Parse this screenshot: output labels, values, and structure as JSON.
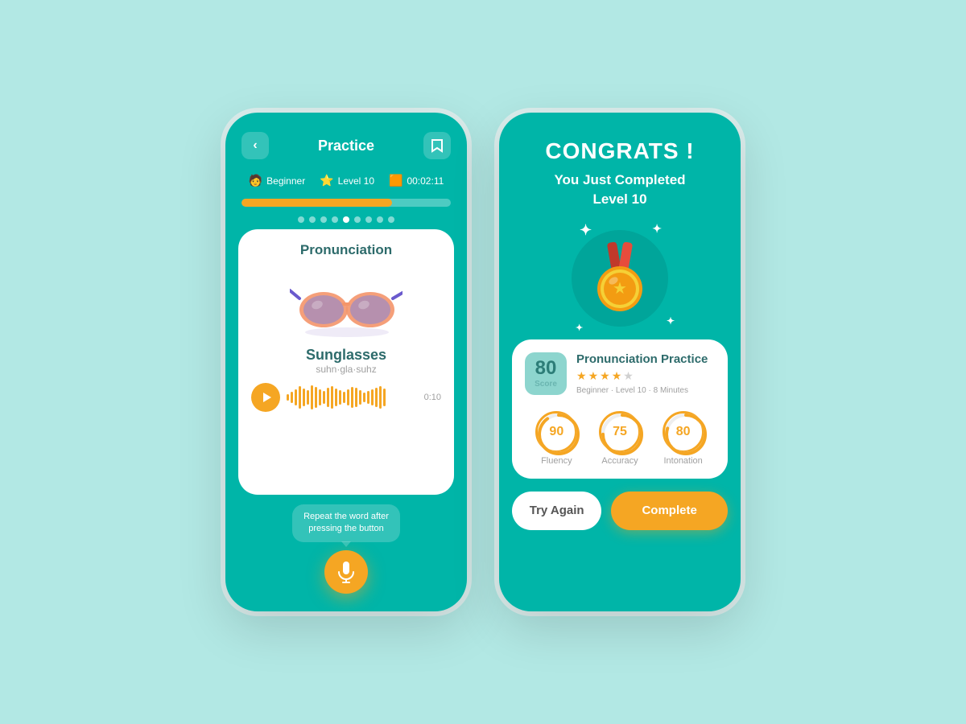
{
  "left_phone": {
    "header": {
      "back_label": "<",
      "title": "Practice",
      "bookmark_label": "🔖"
    },
    "stats": {
      "level_label": "Beginner",
      "star_label": "Level 10",
      "timer_label": "00:02:11"
    },
    "progress": {
      "percentage": 72,
      "dots": [
        1,
        2,
        3,
        4,
        5,
        6,
        7,
        8,
        9
      ],
      "active_dot": 5
    },
    "card": {
      "title": "Pronunciation",
      "word": "Sunglasses",
      "phonetic": "suhn·gla·suhz",
      "time": "0:10"
    },
    "hint": "Repeat the word after\npressing the button",
    "mic_label": "🎤"
  },
  "right_phone": {
    "congrats_title": "CONGRATS !",
    "congrats_subtitle": "You Just Completed\nLevel 10",
    "result_card": {
      "score": "80",
      "score_label": "Score",
      "title": "Pronunciation Practice",
      "stars": [
        true,
        true,
        true,
        true,
        false
      ],
      "meta": "Beginner · Level 10 · 8 Minutes",
      "metrics": [
        {
          "label": "Fluency",
          "value": 90
        },
        {
          "label": "Accuracy",
          "value": 75
        },
        {
          "label": "Intonation",
          "value": 80
        }
      ]
    },
    "buttons": {
      "try_again": "Try Again",
      "complete": "Complete"
    }
  }
}
